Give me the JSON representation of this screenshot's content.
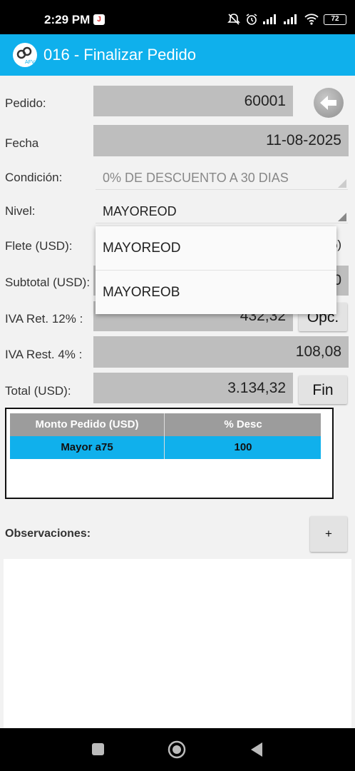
{
  "status_bar": {
    "time": "2:29 PM",
    "battery": "72",
    "app_badge": "J"
  },
  "app_bar": {
    "title": "016 - Finalizar Pedido",
    "logo_text": "AFV"
  },
  "form": {
    "pedido": {
      "label": "Pedido:",
      "value": "60001"
    },
    "fecha": {
      "label": "Fecha",
      "value": "11-08-2025"
    },
    "condicion": {
      "label": "Condición:",
      "value": "0% DE DESCUENTO A 30 DIAS"
    },
    "nivel": {
      "label": "Nivel:",
      "value": "MAYOREOD"
    },
    "flete": {
      "label": "Flete (USD):",
      "partial_right": "%)"
    },
    "subtotal": {
      "label": "Subtotal (USD):",
      "partial_right": "0"
    },
    "iva_ret": {
      "label": "IVA Ret. 12% :",
      "value": "432,32",
      "button": "Opc."
    },
    "iva_rest": {
      "label": "IVA Rest. 4% :",
      "value": "108,08"
    },
    "total": {
      "label": "Total (USD):",
      "value": "3.134,32",
      "button": "Fin"
    }
  },
  "dropdown": {
    "options": [
      "MAYOREOD",
      "MAYOREOB"
    ]
  },
  "discount_table": {
    "headers": [
      "Monto Pedido (USD)",
      "% Desc"
    ],
    "rows": [
      [
        "Mayor a75",
        "100"
      ]
    ]
  },
  "observaciones": {
    "label": "Observaciones:",
    "add_button": "+"
  },
  "colors": {
    "accent": "#0fb0ec",
    "field_bg": "#bebebe",
    "header_bg": "#9c9c9c"
  },
  "icons": [
    "wifi-icon",
    "signal-icon",
    "alarm-icon",
    "mute-icon",
    "back-arrow-icon",
    "nav-square-icon",
    "nav-home-icon",
    "nav-back-icon"
  ]
}
